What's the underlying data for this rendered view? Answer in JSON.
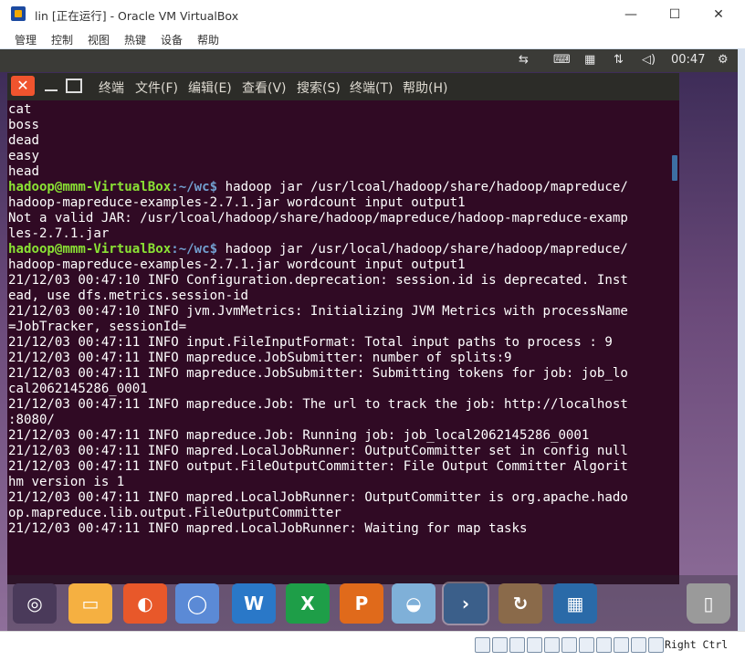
{
  "window": {
    "title": "lin [正在运行] - Oracle VM VirtualBox",
    "controls": {
      "minimize": "—",
      "maximize": "☐",
      "close": "✕"
    }
  },
  "vbox_menu": [
    "管理",
    "控制",
    "视图",
    "热键",
    "设备",
    "帮助"
  ],
  "guest_topbar": {
    "clock": "00:47",
    "tray_icons": [
      "network-icon",
      "keyboard-icon",
      "input-method-icon",
      "transfer-icon",
      "volume-icon",
      "settings-icon"
    ]
  },
  "terminal": {
    "close_glyph": "✕",
    "app_name": "终端",
    "menu": [
      "文件(F)",
      "编辑(E)",
      "查看(V)",
      "搜索(S)",
      "终端(T)",
      "帮助(H)"
    ],
    "prompt_user": "hadoop@mmm-VirtualBox",
    "prompt_path": ":~/wc$",
    "lines": [
      "cat",
      "boss",
      "dead",
      "easy",
      "head",
      "hadoop-mapreduce-examples-2.7.1.jar wordcount input output1",
      "Not a valid JAR: /usr/lcoal/hadoop/share/hadoop/mapreduce/hadoop-mapreduce-examp",
      "les-2.7.1.jar",
      "hadoop-mapreduce-examples-2.7.1.jar wordcount input output1",
      "21/12/03 00:47:10 INFO Configuration.deprecation: session.id is deprecated. Inst",
      "ead, use dfs.metrics.session-id",
      "21/12/03 00:47:10 INFO jvm.JvmMetrics: Initializing JVM Metrics with processName",
      "=JobTracker, sessionId=",
      "21/12/03 00:47:11 INFO input.FileInputFormat: Total input paths to process : 9",
      "21/12/03 00:47:11 INFO mapreduce.JobSubmitter: number of splits:9",
      "21/12/03 00:47:11 INFO mapreduce.JobSubmitter: Submitting tokens for job: job_lo",
      "cal2062145286_0001",
      "21/12/03 00:47:11 INFO mapreduce.Job: The url to track the job: http://localhost",
      ":8080/",
      "21/12/03 00:47:11 INFO mapreduce.Job: Running job: job_local2062145286_0001",
      "21/12/03 00:47:11 INFO mapred.LocalJobRunner: OutputCommitter set in config null",
      "21/12/03 00:47:11 INFO output.FileOutputCommitter: File Output Committer Algorit",
      "hm version is 1",
      "21/12/03 00:47:11 INFO mapred.LocalJobRunner: OutputCommitter is org.apache.hado",
      "op.mapreduce.lib.output.FileOutputCommitter",
      "21/12/03 00:47:11 INFO mapred.LocalJobRunner: Waiting for map tasks"
    ],
    "cmd1": " hadoop jar /usr/lcoal/hadoop/share/hadoop/mapreduce/",
    "cmd2": " hadoop jar /usr/local/hadoop/share/hadoop/mapreduce/"
  },
  "dock_icons": [
    {
      "name": "ubuntu-logo-icon",
      "color": "#4a3a5a"
    },
    {
      "name": "files-icon",
      "color": "#f5b041"
    },
    {
      "name": "firefox-icon",
      "color": "#e8582a"
    },
    {
      "name": "chromium-icon",
      "color": "#5b8ad6"
    },
    {
      "name": "writer-icon",
      "color": "#2a78c8"
    },
    {
      "name": "calc-icon",
      "color": "#1e9e48"
    },
    {
      "name": "impress-icon",
      "color": "#e06a1b"
    },
    {
      "name": "software-center-icon",
      "color": "#7fb0d8"
    },
    {
      "name": "terminal-icon",
      "color": "#3b5f8a"
    },
    {
      "name": "software-updater-icon",
      "color": "#8a6a4a"
    },
    {
      "name": "workspace-switcher-icon",
      "color": "#2a6aa8"
    },
    {
      "name": "trash-icon",
      "color": "#9a9a9a"
    }
  ],
  "statusbar": {
    "host_key": "Right Ctrl"
  }
}
